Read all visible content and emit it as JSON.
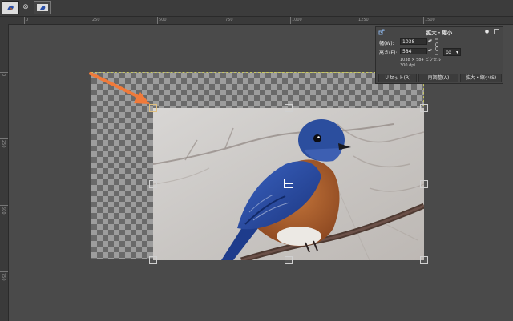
{
  "tabs": [
    {
      "name": "bird-image-tab-1"
    },
    {
      "name": "bird-image-tab-2"
    }
  ],
  "tab_close_glyph": "⊗",
  "ruler": {
    "h_labels": [
      "0",
      "250",
      "500",
      "750",
      "1000",
      "1250",
      "1500"
    ],
    "v_labels": [
      "0",
      "250",
      "500",
      "750"
    ]
  },
  "dialog": {
    "title": "拡大・縮小",
    "width_label": "幅(W):",
    "width_value": "1038",
    "height_label": "高さ(E):",
    "height_value": "584",
    "unit": "px",
    "size_info": "1038 × 584 ピクセル",
    "dpi_info": "300 dpi",
    "buttons": {
      "reset": "リセット(R)",
      "readjust": "再調整(A)",
      "scale": "拡大・縮小(S)"
    }
  },
  "colors": {
    "accent_arrow": "#f07a3a",
    "layer_boundary": "#c8c860",
    "canvas_bg": "#4a4a4a",
    "bird_blue": "#2a4fa8",
    "bird_rust": "#b0622e"
  }
}
